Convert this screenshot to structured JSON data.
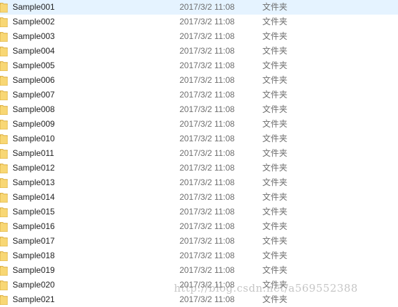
{
  "colors": {
    "folder_fill": "#f8d775",
    "folder_edge": "#dcb045",
    "selected_row": "#e5f3ff",
    "meta_text": "#6d6d6d"
  },
  "file_list": {
    "rows": [
      {
        "name": "Sample001",
        "date": "2017/3/2 11:08",
        "type": "文件夹",
        "icon": "folder-icon",
        "selected": true
      },
      {
        "name": "Sample002",
        "date": "2017/3/2 11:08",
        "type": "文件夹",
        "icon": "folder-icon"
      },
      {
        "name": "Sample003",
        "date": "2017/3/2 11:08",
        "type": "文件夹",
        "icon": "folder-icon"
      },
      {
        "name": "Sample004",
        "date": "2017/3/2 11:08",
        "type": "文件夹",
        "icon": "folder-icon"
      },
      {
        "name": "Sample005",
        "date": "2017/3/2 11:08",
        "type": "文件夹",
        "icon": "folder-icon"
      },
      {
        "name": "Sample006",
        "date": "2017/3/2 11:08",
        "type": "文件夹",
        "icon": "folder-icon"
      },
      {
        "name": "Sample007",
        "date": "2017/3/2 11:08",
        "type": "文件夹",
        "icon": "folder-icon"
      },
      {
        "name": "Sample008",
        "date": "2017/3/2 11:08",
        "type": "文件夹",
        "icon": "folder-icon"
      },
      {
        "name": "Sample009",
        "date": "2017/3/2 11:08",
        "type": "文件夹",
        "icon": "folder-icon"
      },
      {
        "name": "Sample010",
        "date": "2017/3/2 11:08",
        "type": "文件夹",
        "icon": "folder-icon"
      },
      {
        "name": "Sample011",
        "date": "2017/3/2 11:08",
        "type": "文件夹",
        "icon": "folder-icon"
      },
      {
        "name": "Sample012",
        "date": "2017/3/2 11:08",
        "type": "文件夹",
        "icon": "folder-icon"
      },
      {
        "name": "Sample013",
        "date": "2017/3/2 11:08",
        "type": "文件夹",
        "icon": "folder-icon"
      },
      {
        "name": "Sample014",
        "date": "2017/3/2 11:08",
        "type": "文件夹",
        "icon": "folder-icon"
      },
      {
        "name": "Sample015",
        "date": "2017/3/2 11:08",
        "type": "文件夹",
        "icon": "folder-icon"
      },
      {
        "name": "Sample016",
        "date": "2017/3/2 11:08",
        "type": "文件夹",
        "icon": "folder-icon"
      },
      {
        "name": "Sample017",
        "date": "2017/3/2 11:08",
        "type": "文件夹",
        "icon": "folder-icon"
      },
      {
        "name": "Sample018",
        "date": "2017/3/2 11:08",
        "type": "文件夹",
        "icon": "folder-icon"
      },
      {
        "name": "Sample019",
        "date": "2017/3/2 11:08",
        "type": "文件夹",
        "icon": "folder-icon"
      },
      {
        "name": "Sample020",
        "date": "2017/3/2 11:08",
        "type": "文件夹",
        "icon": "folder-icon"
      },
      {
        "name": "Sample021",
        "date": "2017/3/2 11:08",
        "type": "文件夹",
        "icon": "folder-icon"
      }
    ]
  },
  "watermark": {
    "text": "http://blog.csdn.net/a569552388"
  }
}
